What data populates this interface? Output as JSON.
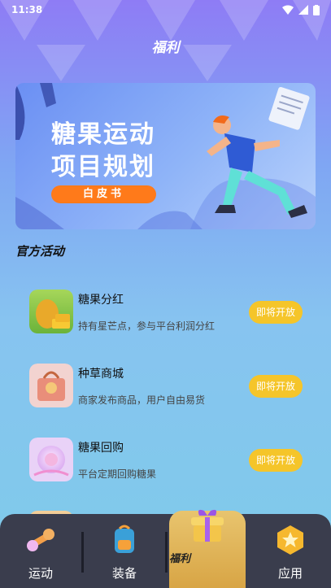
{
  "status_bar": {
    "time": "11:38"
  },
  "page_title": "福利",
  "banner": {
    "line1": "糖果运动",
    "line2": "项目规划",
    "pill": "白皮书"
  },
  "section_title": "官方活动",
  "activities": [
    {
      "name": "糖果分红",
      "desc": "持有星芒点，参与平台利润分红",
      "button": "即将开放"
    },
    {
      "name": "种草商城",
      "desc": "商家发布商品，用户自由易货",
      "button": "即将开放"
    },
    {
      "name": "糖果回购",
      "desc": "平台定期回购糖果",
      "button": "即将开放"
    }
  ],
  "tabs": [
    {
      "label": "运动",
      "icon": "dumbbell-icon"
    },
    {
      "label": "装备",
      "icon": "backpack-icon"
    },
    {
      "label": "福利",
      "icon": "gift-box-icon"
    },
    {
      "label": "应用",
      "icon": "star-badge-icon"
    }
  ],
  "colors": {
    "button": "#f5c52a",
    "tab_bar": "#3a3d4d",
    "active_tab": "#d8a545",
    "pill": "#ff7a1a"
  }
}
